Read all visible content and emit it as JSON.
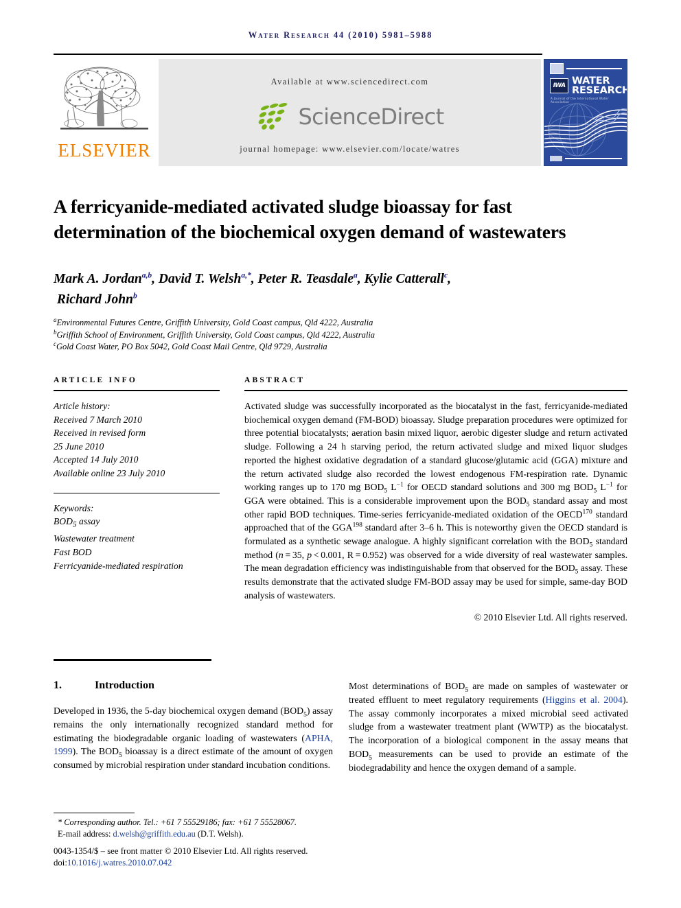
{
  "running_head": "Water Research 44 (2010) 5981–5988",
  "header": {
    "elsevier_wordmark": "ELSEVIER",
    "available_at": "Available at www.sciencedirect.com",
    "sciencedirect_wordmark": "ScienceDirect",
    "journal_homepage": "journal homepage: www.elsevier.com/locate/watres",
    "cover": {
      "iwa_label": "IWA",
      "title_line1": "WATER",
      "title_line2": "RESEARCH",
      "subtitle": "A Journal of the International Water Association"
    }
  },
  "article": {
    "title": "A ferricyanide-mediated activated sludge bioassay for fast determination of the biochemical oxygen demand of wastewaters",
    "authors_html": "Mark A. Jordan<sup>a,b</sup>, David T. Welsh<sup>a,*</sup>, Peter R. Teasdale<sup>a</sup>, Kylie Catterall<sup>c</sup>,<br> Richard John<sup>b</sup>",
    "affiliations": [
      {
        "marker": "a",
        "text": "Environmental Futures Centre, Griffith University, Gold Coast campus, Qld 4222, Australia"
      },
      {
        "marker": "b",
        "text": "Griffith School of Environment, Griffith University, Gold Coast campus, Qld 4222, Australia"
      },
      {
        "marker": "c",
        "text": "Gold Coast Water, PO Box 5042, Gold Coast Mail Centre, Qld 9729, Australia"
      }
    ]
  },
  "article_info": {
    "heading": "ARTICLE INFO",
    "history_label": "Article history:",
    "history": [
      "Received 7 March 2010",
      "Received in revised form",
      "25 June 2010",
      "Accepted 14 July 2010",
      "Available online 23 July 2010"
    ],
    "keywords_label": "Keywords:",
    "keywords_html": [
      "BOD<sub>5</sub> assay",
      "Wastewater treatment",
      "Fast BOD",
      "Ferricyanide-mediated respiration"
    ]
  },
  "abstract": {
    "heading": "ABSTRACT",
    "body_html": "Activated sludge was successfully incorporated as the biocatalyst in the fast, ferricyanide-mediated biochemical oxygen demand (FM-BOD) bioassay. Sludge preparation procedures were optimized for three potential biocatalysts; aeration basin mixed liquor, aerobic digester sludge and return activated sludge. Following a 24 h starving period, the return activated sludge and mixed liquor sludges reported the highest oxidative degradation of a standard glucose/glutamic acid (GGA) mixture and the return activated sludge also recorded the lowest endogenous FM-respiration rate. Dynamic working ranges up to 170 mg BOD<sub>5</sub> L<sup>−1</sup> for OECD standard solutions and 300 mg BOD<sub>5</sub> L<sup>−1</sup> for GGA were obtained. This is a considerable improvement upon the BOD<sub>5</sub> standard assay and most other rapid BOD techniques. Time-series ferricyanide-mediated oxidation of the OECD<sup>170</sup> standard approached that of the GGA<sup>198</sup> standard after 3–6 h. This is noteworthy given the OECD standard is formulated as a synthetic sewage analogue. A highly significant correlation with the BOD<sub>5</sub> standard method (<i>n</i> = 35, <i>p</i> &lt; 0.001, R = 0.952) was observed for a wide diversity of real wastewater samples. The mean degradation efficiency was indistinguishable from that observed for the BOD<sub>5</sub> assay. These results demonstrate that the activated sludge FM-BOD assay may be used for simple, same-day BOD analysis of wastewaters.",
    "copyright": "© 2010 Elsevier Ltd. All rights reserved."
  },
  "introduction": {
    "number": "1.",
    "heading": "Introduction",
    "left_html": "Developed in 1936, the 5-day biochemical oxygen demand (BOD<sub>5</sub>) assay remains the only internationally recognized standard method for estimating the biodegradable organic loading of wastewaters (<span class=\"ref-link\">APHA, 1999</span>). The BOD<sub>5</sub> bioassay is a direct estimate of the amount of oxygen consumed by microbial respiration under standard incubation conditions.",
    "right_html": "Most determinations of BOD<sub>5</sub> are made on samples of wastewater or treated effluent to meet regulatory requirements (<span class=\"ref-link\">Higgins et al. 2004</span>). The assay commonly incorporates a mixed microbial seed activated sludge from a wastewater treatment plant (WWTP) as the biocatalyst. The incorporation of a biological component in the assay means that BOD<sub>5</sub> measurements can be used to provide an estimate of the biodegradability and hence the oxygen demand of a sample."
  },
  "footer": {
    "corresponding_html": "<span class=\"fn-corr\">* Corresponding author. Tel.: +61 7 55529186; fax: +61 7 55528067.</span>",
    "email_html": "E-mail address: <span class=\"ref-link\">d.welsh@griffith.edu.au</span> (D.T. Welsh).",
    "imprint_html": "0043-1354/$ – see front matter © 2010 Elsevier Ltd. All rights reserved.",
    "doi_html": "doi:<span class=\"ref-link\">10.1016/j.watres.2010.07.042</span>"
  },
  "colors": {
    "running_head": "#1a1a5e",
    "elsevier_orange": "#f08000",
    "link_blue": "#1a3fa0",
    "cover_blue": "#2b4a9b",
    "band_gray": "#e8e8e8",
    "sd_green": "#7ab317",
    "sd_gray": "#7d7d7d"
  }
}
